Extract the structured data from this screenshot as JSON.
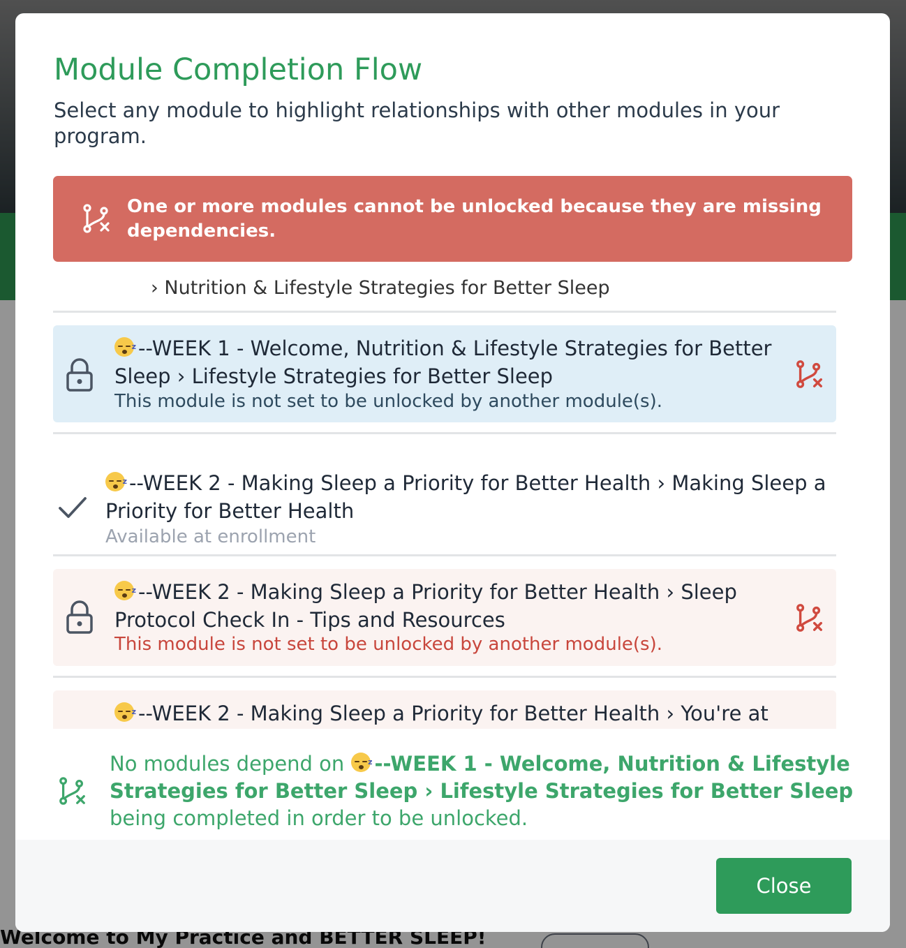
{
  "background": {
    "footer_text": "Welcome to My Practice and BETTER SLEEP!"
  },
  "modal": {
    "title": "Module Completion Flow",
    "description": "Select any module to highlight relationships with other modules in your program.",
    "alert": {
      "icon": "branch-x-icon",
      "text": "One or more modules cannot be unlocked because they are missing dependencies.",
      "color": "#d46b61"
    },
    "list": {
      "cut_text": "› Nutrition & Lifestyle Strategies for Better Sleep",
      "items": [
        {
          "emoji": "sleeping-face-emoji",
          "title": "--WEEK 1 - Welcome, Nutrition & Lifestyle Strategies for Better Sleep › Lifestyle Strategies for Better Sleep",
          "subtitle": "This module is not set to be unlocked by another module(s).",
          "status_icon": "lock-icon",
          "flag_icon": "branch-x-icon",
          "selected": true
        },
        {
          "emoji": "sleeping-face-emoji",
          "title": "--WEEK 2 - Making Sleep a Priority for Better Health › Making Sleep a Priority for Better Health",
          "subtitle": "Available at enrollment",
          "status_icon": "check-icon"
        },
        {
          "emoji": "sleeping-face-emoji",
          "title": "--WEEK 2 - Making Sleep a Priority for Better Health › Sleep Protocol Check In - Tips and Resources",
          "subtitle": "This module is not set to be unlocked by another module(s).",
          "status_icon": "lock-icon",
          "flag_icon": "branch-x-icon"
        },
        {
          "emoji": "sleeping-face-emoji",
          "title": "--WEEK 2 - Making Sleep a Priority for Better Health › You're at"
        }
      ]
    },
    "info": {
      "prefix": "No modules depend on",
      "module": "--WEEK 1 - Welcome, Nutrition & Lifestyle Strategies for Better Sleep › Lifestyle Strategies for Better Sleep",
      "suffix": "being completed in order to be unlocked."
    },
    "close_label": "Close"
  },
  "colors": {
    "brand_green": "#2e9b5a",
    "alert_red": "#d46b61",
    "error_text": "#c8463c",
    "selected_bg": "#dfeef7",
    "warning_bg": "#fbf3f1"
  }
}
